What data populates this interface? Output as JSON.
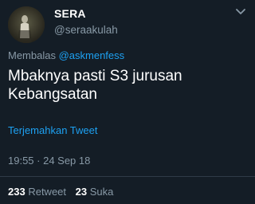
{
  "tweet": {
    "user": {
      "name": "SERA",
      "handle": "@seraakulah"
    },
    "reply_prefix": "Membalas",
    "reply_mention": "@askmenfess",
    "text": "Mbaknya pasti S3 jurusan Kebangsatan",
    "translate_label": "Terjemahkan Tweet",
    "timestamp": "19:55 · 24 Sep 18",
    "retweets": {
      "count": "233",
      "label": "Retweet"
    },
    "likes": {
      "count": "23",
      "label": "Suka"
    }
  },
  "colors": {
    "background": "#141d26",
    "accent": "#1da1f2",
    "muted": "#8899a6"
  },
  "icons": [
    "avatar",
    "chevron-down-icon"
  ]
}
